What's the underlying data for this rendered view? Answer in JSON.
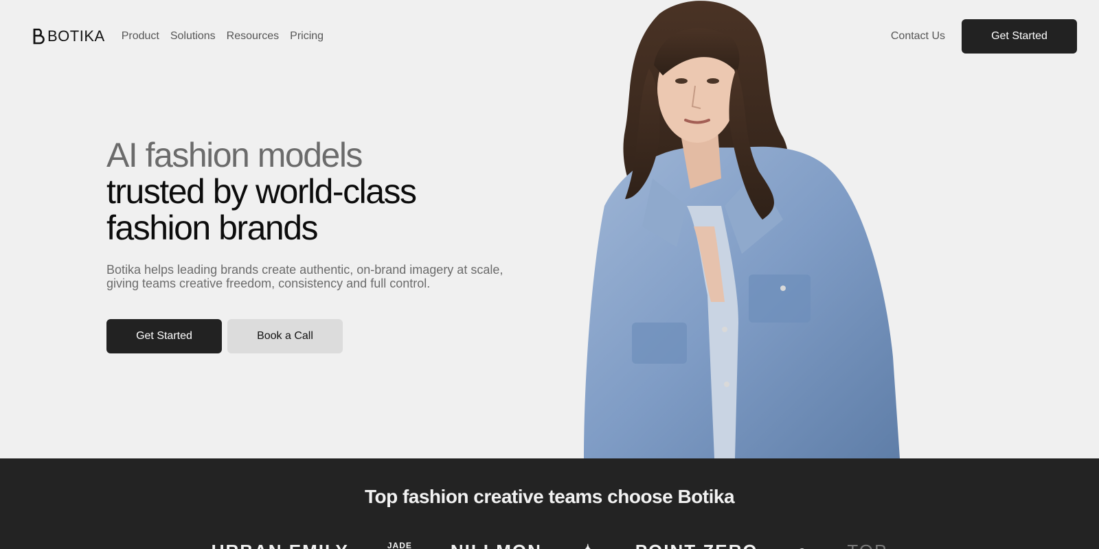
{
  "nav": {
    "brand": "BOTIKA",
    "links": [
      "Product",
      "Solutions",
      "Resources",
      "Pricing"
    ],
    "contact": "Contact Us",
    "cta": "Get Started"
  },
  "hero": {
    "headline_muted": "AI fashion models",
    "headline_line2": "trusted by world-class",
    "headline_line3": "fashion brands",
    "subtext_line1": "Botika helps leading brands create authentic, on-brand imagery at scale,",
    "subtext_line2": "giving teams creative freedom, consistency and full control.",
    "primary_cta": "Get Started",
    "secondary_cta": "Book a Call"
  },
  "logos_band": {
    "title": "Top fashion creative teams choose Botika",
    "brands": [
      "URBAN EMILY",
      "JADE",
      "NILI MON",
      "✦",
      "POINT ZERO",
      "●",
      "TOP"
    ]
  },
  "colors": {
    "page_bg": "#f0f0f0",
    "dark": "#222222",
    "muted_text": "#6b6b6b",
    "band_bg": "#232323",
    "denim": "#7f9cc5"
  }
}
